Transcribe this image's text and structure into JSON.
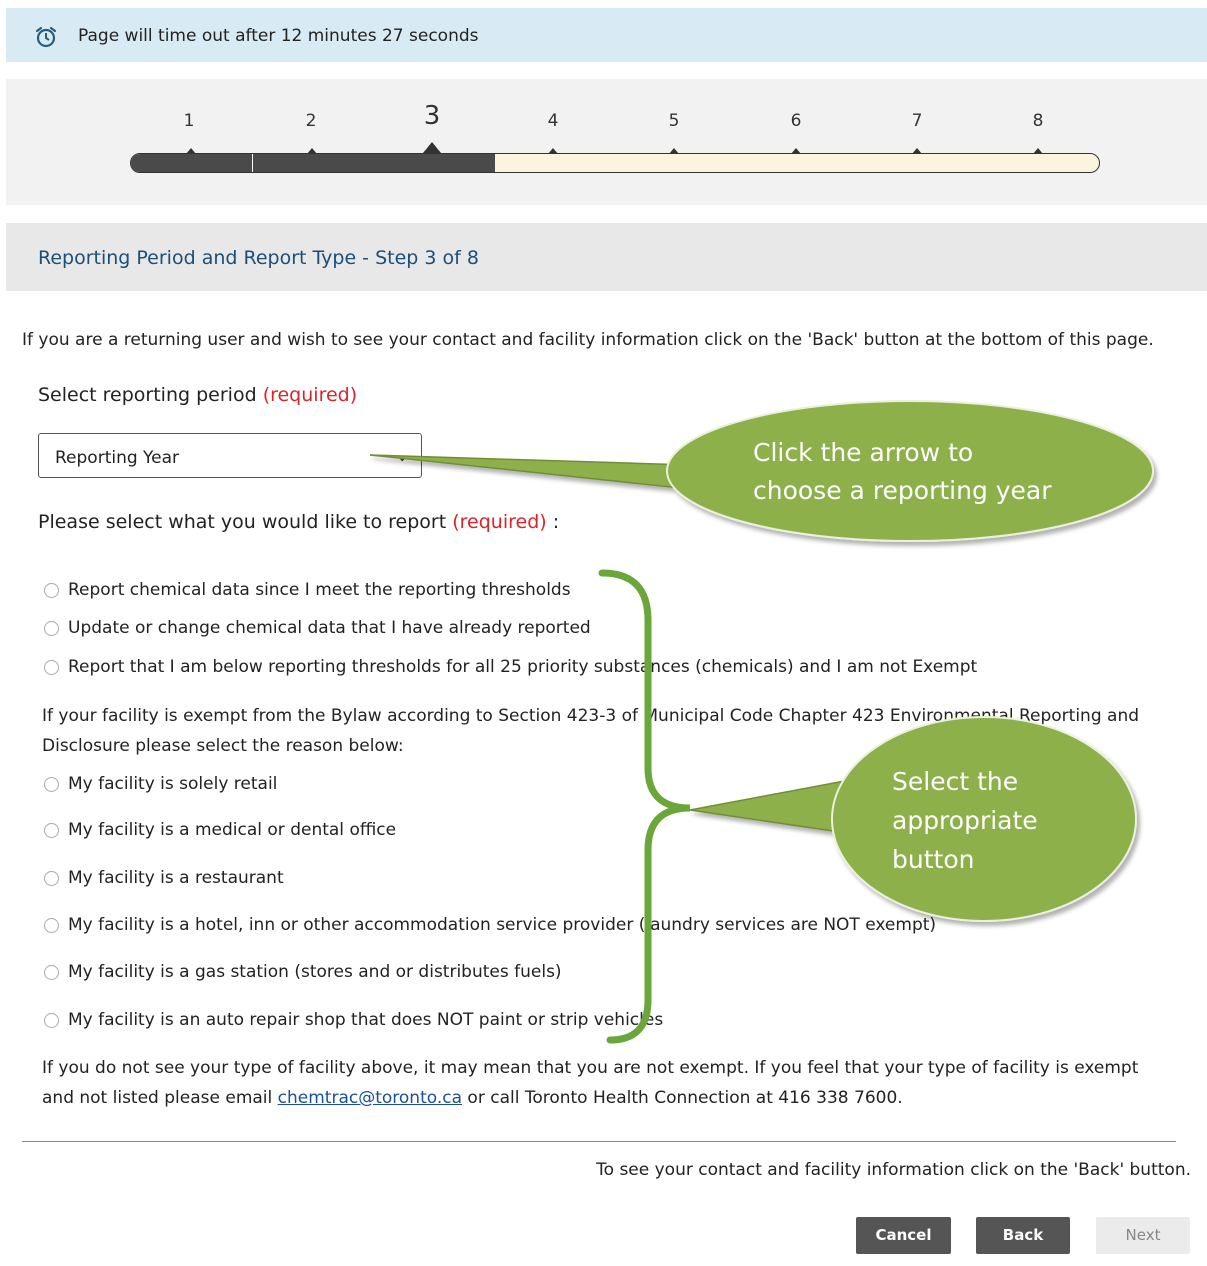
{
  "timeout": {
    "icon": "alarm-clock-icon",
    "text": "Page will time out after 12 minutes 27 seconds"
  },
  "progress": {
    "steps": [
      "1",
      "2",
      "3",
      "4",
      "5",
      "6",
      "7",
      "8"
    ],
    "current_step": 3,
    "total_steps": 8
  },
  "section": {
    "title": "Reporting Period and Report Type - Step 3 of 8"
  },
  "intro_text": "If you are a returning user and wish to see your contact and facility information click on the 'Back' button at the bottom of this page.",
  "reporting_period": {
    "label": "Select reporting period",
    "required": "(required)",
    "selected_value": "Reporting Year"
  },
  "report_type": {
    "label": "Please select what you would like to report",
    "required": "(required)",
    "suffix": ":"
  },
  "options_group1": [
    "Report chemical data since I meet the reporting thresholds",
    "Update or change chemical data that I have already reported",
    "Report that I am below reporting thresholds for all 25 priority substances (chemicals) and I am not Exempt"
  ],
  "exempt_note": "If your facility is exempt from the Bylaw according to Section 423-3 of Municipal Code Chapter 423 Environmental Reporting and Disclosure please select the reason below:",
  "options_exempt": [
    "My facility is solely retail",
    "My facility is a medical or dental office",
    "My facility is a restaurant",
    "My facility is a hotel, inn or other accommodation service provider (laundry services are NOT exempt)",
    "My facility is a gas station (stores and or distributes fuels)",
    "My facility is an auto repair shop that does NOT paint or strip vehicles"
  ],
  "footer_note": {
    "text_before": "If you do not see your type of facility above, it may mean that you are not exempt. If you feel that your type of facility is exempt and not listed please email",
    "email": "chemtrac@toronto.ca",
    "text_after": "or call Toronto Health Connection at 416 338 7600."
  },
  "bottom_note": "To see your contact and facility information click on the 'Back' button.",
  "buttons": {
    "cancel": "Cancel",
    "back": "Back",
    "next": "Next"
  },
  "callouts": {
    "arrow_line1": "Click the arrow to",
    "arrow_line2": "choose a reporting year",
    "select_line1": "Select the",
    "select_line2": "appropriate",
    "select_line3": "button",
    "color": "#8db04b",
    "bracket_color": "#6aa639"
  }
}
